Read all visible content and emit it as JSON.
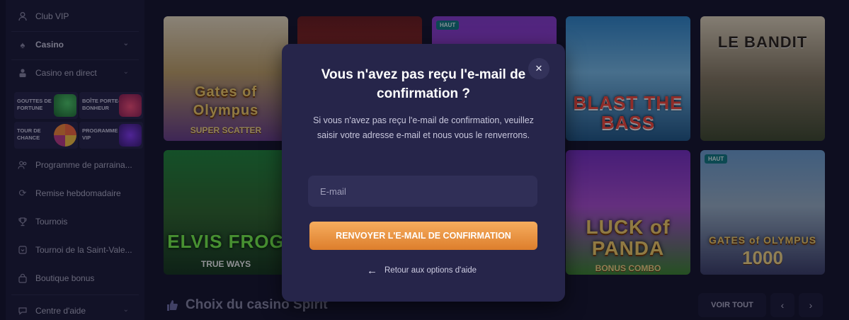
{
  "sidebar": {
    "items": [
      {
        "label": "Club VIP",
        "icon": "user-icon"
      },
      {
        "label": "Casino",
        "icon": "spade-icon"
      },
      {
        "label": "Casino en direct",
        "icon": "dealer-icon"
      },
      {
        "label": "Programme de parraina...",
        "icon": "people-icon"
      },
      {
        "label": "Remise hebdomadaire",
        "icon": "refresh-icon"
      },
      {
        "label": "Tournois",
        "icon": "trophy-icon"
      },
      {
        "label": "Tournoi de la Saint-Vale...",
        "icon": "tournament-icon"
      },
      {
        "label": "Boutique bonus",
        "icon": "bag-icon"
      },
      {
        "label": "Centre d'aide",
        "icon": "chat-icon"
      }
    ],
    "promos": [
      {
        "label": "GOUTTES DE FORTUNE"
      },
      {
        "label": "BOÎTE PORTE-BONHEUR"
      },
      {
        "label": "TOUR DE CHANCE"
      },
      {
        "label": "PROGRAMME VIP"
      }
    ]
  },
  "games": [
    {
      "title": "Gates of Olympus",
      "subtitle": "SUPER SCATTER",
      "badge": ""
    },
    {
      "title": "",
      "subtitle": "",
      "badge": ""
    },
    {
      "title": "",
      "subtitle": "",
      "badge": "HAUT"
    },
    {
      "title": "BLAST THE BASS",
      "subtitle": "",
      "badge": ""
    },
    {
      "title": "LE BANDIT",
      "subtitle": "",
      "badge": ""
    },
    {
      "title": "ELVIS FROG",
      "subtitle": "TRUE WAYS",
      "badge": ""
    },
    {
      "title": "LUCK of PANDA",
      "subtitle": "BONUS COMBO",
      "badge": ""
    },
    {
      "title": "GATES of OLYMPUS",
      "subtitle": "1000",
      "badge": "HAUT"
    }
  ],
  "section": {
    "title": "Choix du casino Spirit",
    "see_all": "VOIR TOUT"
  },
  "modal": {
    "title": "Vous n'avez pas reçu l'e-mail de confirmation ?",
    "body": "Si vous n'avez pas reçu l'e-mail de confirmation, veuillez saisir votre adresse e-mail et nous vous le renverrons.",
    "email_placeholder": "E-mail",
    "email_value": "",
    "resend_button": "RENVOYER L'E-MAIL DE CONFIRMATION",
    "back_link": "Retour aux options d'aide"
  },
  "colors": {
    "accent_orange": "#f0a04b",
    "background": "#13132a",
    "sidebar": "#1b1a38",
    "modal": "#26254a",
    "badge": "#0f7f86"
  }
}
